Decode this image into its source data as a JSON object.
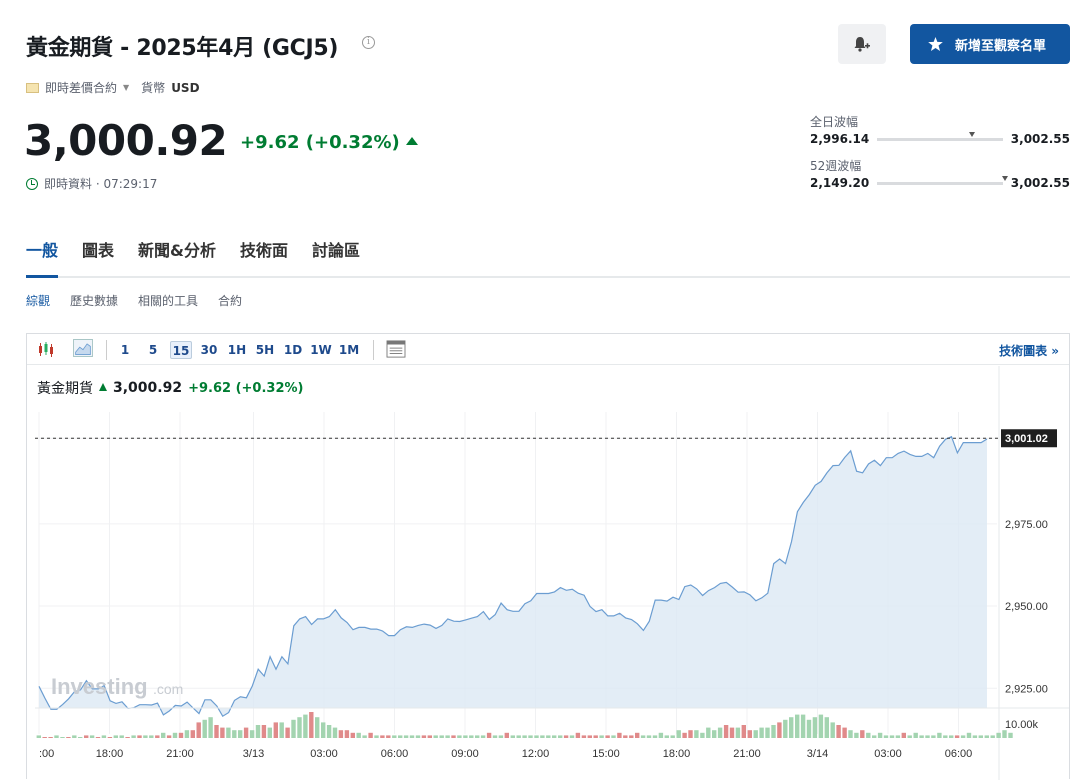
{
  "header": {
    "title": "黃金期貨 - 2025年4月 (GCJ5)",
    "watch_label": "新增至觀察名單",
    "contract_type": "即時差價合約",
    "currency_label": "貨幣",
    "currency": "USD",
    "price": "3,000.92",
    "change": "+9.62 (+0.32%)",
    "time_text": "即時資料 · 07:29:17"
  },
  "ranges": {
    "day": {
      "label": "全日波幅",
      "low": "2,996.14",
      "high": "3,002.55",
      "marker": 0.73
    },
    "week52": {
      "label": "52週波幅",
      "low": "2,149.20",
      "high": "3,002.55",
      "marker": 0.99
    }
  },
  "tabs": [
    "一般",
    "圖表",
    "新聞&分析",
    "技術面",
    "討論區"
  ],
  "subtabs": [
    "綜觀",
    "歷史數據",
    "相關的工具",
    "合約"
  ],
  "toolbar": {
    "intervals": [
      "1",
      "5",
      "15",
      "30",
      "1H",
      "5H",
      "1D",
      "1W",
      "1M"
    ],
    "selected": "15",
    "tech_link": "技術圖表 »"
  },
  "legend": {
    "name": "黃金期貨",
    "price": "3,000.92",
    "change": "+9.62 (+0.32%)"
  },
  "colors": {
    "up": "#007c32",
    "accent": "#1256a0",
    "line": "#6b9dd1",
    "area": "#dce8f4",
    "vol_up": "#a3d4b0",
    "vol_down": "#e08a8a"
  },
  "chart_data": {
    "type": "area",
    "y_ticks": [
      "3,001.02",
      "2,975.00",
      "2,950.00",
      "2,925.00"
    ],
    "volume_label": "10.00k",
    "last_value": "3,001.02",
    "x_ticks": [
      ":00",
      "18:00",
      "21:00",
      "3/13",
      "03:00",
      "06:00",
      "09:00",
      "12:00",
      "15:00",
      "18:00",
      "21:00",
      "3/14",
      "03:00",
      "06:00"
    ],
    "ylim": [
      2919,
      3009
    ],
    "values": [
      2925.6,
      2922,
      2918.6,
      2918.6,
      2920.1,
      2921.8,
      2924,
      2924.5,
      2927.3,
      2924.8,
      2924.8,
      2925.8,
      2921.2,
      2920.4,
      2920.9,
      2918.9,
      2919.1,
      2920,
      2920,
      2919.9,
      2920.5,
      2916.9,
      2918.1,
      2919.8,
      2919.6,
      2920.8,
      2919,
      2917.3,
      2921.5,
      2921.5,
      2919.6,
      2916.5,
      2917.6,
      2921.3,
      2922.4,
      2922.1,
      2925.7,
      2930.8,
      2928.7,
      2934.6,
      2930.8,
      2934.6,
      2932.4,
      2944,
      2946.1,
      2946.8,
      2944.4,
      2946.1,
      2946.1,
      2946.8,
      2948.9,
      2946.4,
      2945,
      2942.8,
      2943.5,
      2943.5,
      2943,
      2943,
      2942.4,
      2941,
      2941,
      2942.8,
      2943.7,
      2943.5,
      2944.1,
      2944.5,
      2944.2,
      2943.2,
      2944.1,
      2946.1,
      2945.4,
      2945.3,
      2945.8,
      2946.3,
      2946.8,
      2948.3,
      2945.9,
      2947.4,
      2950.9,
      2948.9,
      2948.4,
      2948.4,
      2950.7,
      2951.6,
      2953.8,
      2953.8,
      2953.8,
      2954.3,
      2955.6,
      2954.8,
      2955.1,
      2953.9,
      2953.3,
      2949.9,
      2948.3,
      2948.9,
      2947,
      2947,
      2947.8,
      2946.4,
      2945.9,
      2944.6,
      2942.6,
      2945.4,
      2951.8,
      2951.8,
      2951.5,
      2952.7,
      2952,
      2955.9,
      2956.4,
      2955.2,
      2953.2,
      2954.7,
      2955.6,
      2956.9,
      2957.2,
      2955.8,
      2954.2,
      2954.3,
      2953.4,
      2951.6,
      2952.5,
      2953.9,
      2962.9,
      2964.3,
      2962.9,
      2969.6,
      2978.7,
      2981.5,
      2983.9,
      2986.7,
      2987.9,
      2990.5,
      2992.7,
      2992.8,
      2995.2,
      2997.2,
      2991,
      2990.5,
      2993.2,
      2994.3,
      2992.7,
      2995.1,
      2995.1,
      2996.4,
      2997.1,
      2996.1,
      2995.5,
      2995.5,
      2996.4,
      2995.1,
      2998.6,
      3000.7,
      3001.5,
      2996.6,
      2999.7,
      2999.7,
      2999.7,
      2999.7,
      3000.8
    ],
    "volume": [
      1,
      0,
      0,
      1,
      0,
      0,
      1,
      0,
      1,
      1,
      0,
      1,
      0,
      1,
      1,
      0,
      1,
      1,
      1,
      1,
      1,
      2,
      1,
      2,
      2,
      3,
      3,
      6,
      7,
      8,
      5,
      4,
      4,
      3,
      3,
      4,
      3,
      5,
      5,
      4,
      6,
      6,
      4,
      7,
      8,
      9,
      10,
      8,
      6,
      5,
      4,
      3,
      3,
      2,
      2,
      1,
      2,
      1,
      1,
      1,
      1,
      1,
      1,
      1,
      1,
      1,
      1,
      1,
      1,
      1,
      1,
      1,
      1,
      1,
      1,
      1,
      2,
      1,
      1,
      2,
      1,
      1,
      1,
      1,
      1,
      1,
      1,
      1,
      1,
      1,
      1,
      2,
      1,
      1,
      1,
      1,
      1,
      1,
      2,
      1,
      1,
      2,
      1,
      1,
      1,
      2,
      1,
      1,
      3,
      2,
      3,
      3,
      2,
      4,
      3,
      4,
      5,
      4,
      4,
      5,
      3,
      3,
      4,
      4,
      5,
      6,
      7,
      8,
      9,
      9,
      7,
      8,
      9,
      8,
      6,
      5,
      4,
      3,
      2,
      3,
      2,
      1,
      2,
      1,
      1,
      1,
      2,
      1,
      2,
      1,
      1,
      1,
      2,
      1,
      1,
      1,
      1,
      2,
      1,
      1,
      1,
      1,
      2,
      3,
      2
    ],
    "volume_dir": [
      1,
      0,
      0,
      1,
      1,
      0,
      1,
      1,
      0,
      1,
      0,
      1,
      0,
      1,
      1,
      0,
      1,
      0,
      1,
      1,
      0,
      1,
      0,
      1,
      0,
      1,
      0,
      0,
      1,
      1,
      0,
      0,
      1,
      1,
      1,
      0,
      1,
      1,
      0,
      1,
      0,
      1,
      0,
      1,
      1,
      1,
      0,
      1,
      1,
      1,
      1,
      0,
      0,
      0,
      1,
      1,
      0,
      1,
      0,
      0,
      1,
      1,
      1,
      1,
      1,
      0,
      0,
      1,
      1,
      1,
      0,
      1,
      1,
      1,
      1,
      1,
      0,
      1,
      1,
      0,
      1,
      1,
      1,
      1,
      1,
      1,
      1,
      1,
      1,
      0,
      1,
      0,
      0,
      0,
      0,
      1,
      0,
      1,
      0,
      0,
      0,
      0,
      1,
      1,
      1,
      1,
      1,
      1,
      1,
      0,
      0,
      1,
      1,
      1,
      1,
      1,
      0,
      0,
      1,
      0,
      0,
      1,
      1,
      1,
      1,
      0,
      1,
      1,
      1,
      1,
      1,
      1,
      1,
      1,
      1,
      0,
      0,
      1,
      1,
      0,
      1,
      1,
      1,
      1,
      1,
      1,
      0,
      1,
      1,
      1,
      1,
      1,
      1,
      1,
      1,
      0,
      1,
      1,
      1,
      1,
      1,
      1,
      1,
      1,
      1
    ]
  }
}
